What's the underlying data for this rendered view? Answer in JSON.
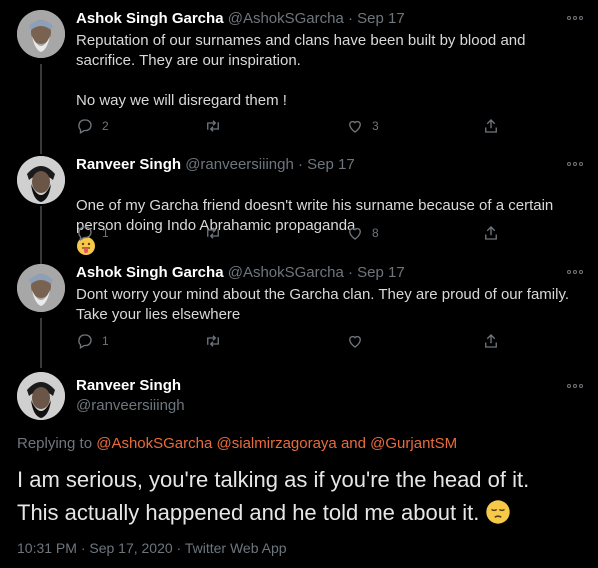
{
  "tweets": [
    {
      "name": "Ashok Singh Garcha",
      "handle": "@AshokSGarcha",
      "date": "· Sep 17",
      "text": "Reputation of our surnames and clans have been built by blood and sacrifice. They are our inspiration.\n\nNo way we will disregard them !",
      "replies": "2",
      "likes": "3"
    },
    {
      "name": "Ranveer Singh",
      "handle": "@ranveersiiingh",
      "date": "· Sep 17",
      "text": "One of my Garcha friend doesn't write his surname because of a certain person doing Indo Abrahamic propaganda",
      "replies": "1",
      "likes": "8"
    },
    {
      "name": "Ashok Singh Garcha",
      "handle": "@AshokSGarcha",
      "date": "· Sep 17",
      "text": "Dont worry your mind about the Garcha clan. They are proud of our family. Take your lies elsewhere",
      "replies": "1",
      "likes": ""
    }
  ],
  "main": {
    "name": "Ranveer Singh",
    "handle": "@ranveersiiingh",
    "replying_prefix": "Replying to",
    "replying_to_1": "@AshokSGarcha",
    "replying_to_2": "@sialmirzagoraya",
    "replying_and": "and",
    "replying_to_3": "@GurjantSM",
    "line1": "I am serious, you're talking as if you're the head of it.",
    "line2": "This actually happened and he told me about it.",
    "footer": "10:31 PM · Sep 17, 2020 · Twitter Web App"
  },
  "icons": [
    "reply-icon",
    "retweet-icon",
    "like-icon",
    "share-icon",
    "more-icon",
    "tongue-emoji",
    "pensive-emoji"
  ],
  "colors": {
    "background": "#000000",
    "link": "#ea6b3d",
    "muted": "#6e767d"
  }
}
